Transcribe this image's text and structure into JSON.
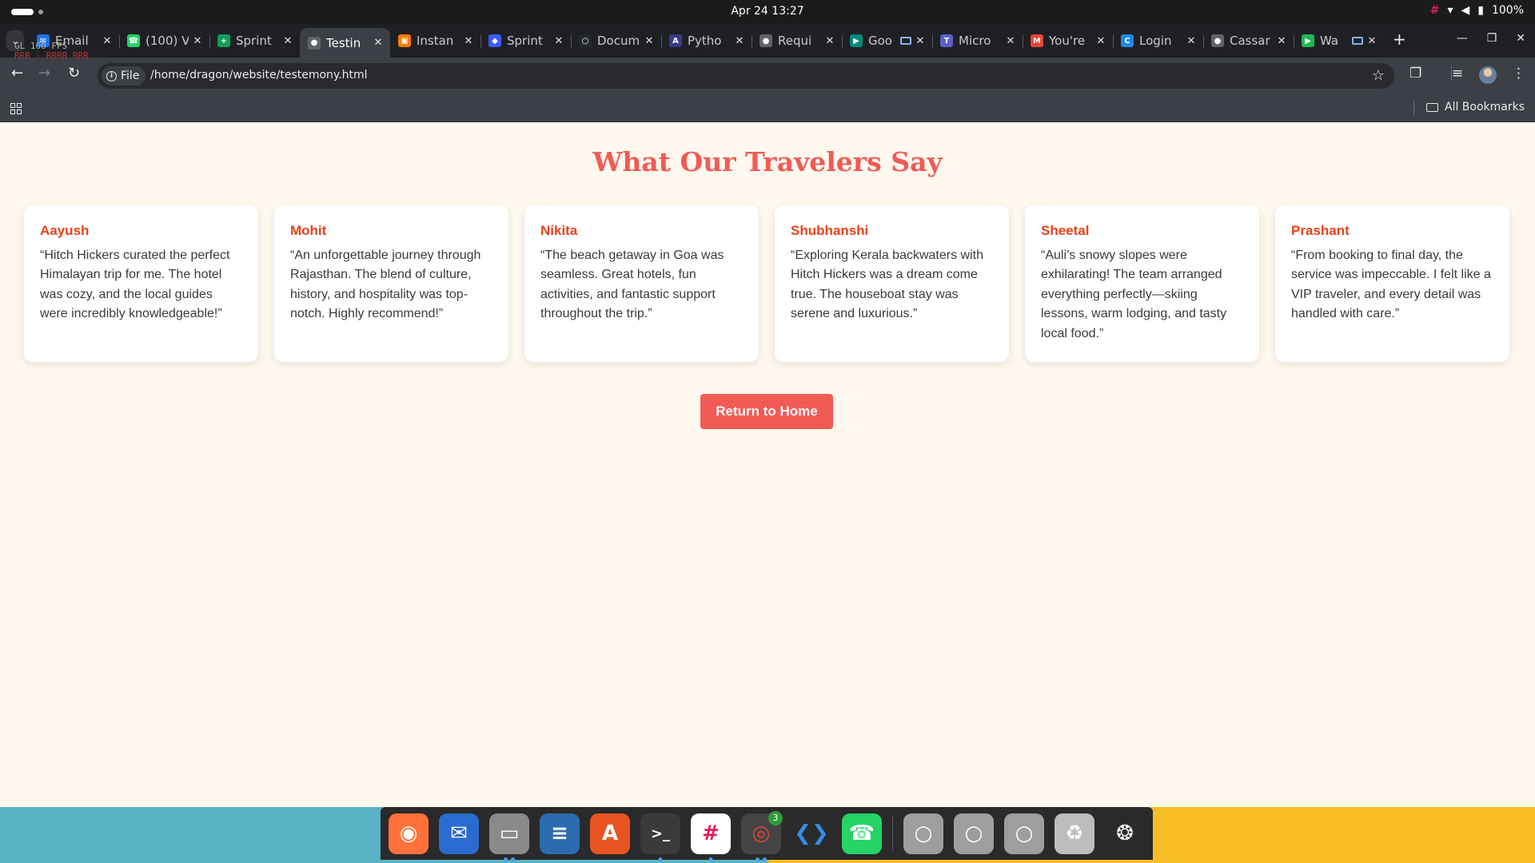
{
  "system": {
    "datetime": "Apr 24  13:27",
    "battery": "100%"
  },
  "overlay": {
    "line1": "GL 100 FPS",
    "line2": "RRR - RRRR RRR"
  },
  "tabs": [
    {
      "title": "Email",
      "icon": "email-icon",
      "color": "#1a73e8",
      "glyph": "✉"
    },
    {
      "title": "(100) V",
      "icon": "whatsapp-icon",
      "color": "#25d366",
      "glyph": "☎"
    },
    {
      "title": "Sprint",
      "icon": "sheets-icon",
      "color": "#0f9d58",
      "glyph": "+"
    },
    {
      "title": "Testin",
      "icon": "globe-icon",
      "color": "#5f6368",
      "glyph": "●",
      "active": true
    },
    {
      "title": "Instan",
      "icon": "instance-icon",
      "color": "#f57c00",
      "glyph": "▣"
    },
    {
      "title": "Sprint",
      "icon": "jira-icon",
      "color": "#3d5afe",
      "glyph": "◆"
    },
    {
      "title": "Docum",
      "icon": "github-icon",
      "color": "#24292e",
      "glyph": "○"
    },
    {
      "title": "Pytho",
      "icon": "python-icon",
      "color": "#3a3a8a",
      "glyph": "A"
    },
    {
      "title": "Requi",
      "icon": "globe-icon",
      "color": "#5f6368",
      "glyph": "●"
    },
    {
      "title": "Goo",
      "icon": "meet-icon",
      "color": "#00897b",
      "glyph": "▶",
      "extra": true
    },
    {
      "title": "Micro",
      "icon": "teams-icon",
      "color": "#5b5fc7",
      "glyph": "T"
    },
    {
      "title": "You're",
      "icon": "gmail-icon",
      "color": "#ea4335",
      "glyph": "M"
    },
    {
      "title": "Login",
      "icon": "login-icon",
      "color": "#1e88e5",
      "glyph": "C"
    },
    {
      "title": "Cassar",
      "icon": "globe-icon",
      "color": "#5f6368",
      "glyph": "●"
    },
    {
      "title": "Wa",
      "icon": "play-icon",
      "color": "#1db954",
      "glyph": "▶",
      "extra": true
    }
  ],
  "toolbar": {
    "chip_label": "File",
    "url": "/home/dragon/website/testemony.html"
  },
  "bookmarks": {
    "all_label": "All Bookmarks"
  },
  "page": {
    "title": "What Our Travelers Say",
    "testimonials": [
      {
        "name": "Aayush",
        "text": "“Hitch Hickers curated the perfect Himalayan trip for me. The hotel was cozy, and the local guides were incredibly knowledgeable!”"
      },
      {
        "name": "Mohit",
        "text": "“An unforgettable journey through Rajasthan. The blend of culture, history, and hospitality was top-notch. Highly recommend!”"
      },
      {
        "name": "Nikita",
        "text": "“The beach getaway in Goa was seamless. Great hotels, fun activities, and fantastic support throughout the trip.”"
      },
      {
        "name": "Shubhanshi",
        "text": "“Exploring Kerala backwaters with Hitch Hickers was a dream come true. The houseboat stay was serene and luxurious.”"
      },
      {
        "name": "Sheetal",
        "text": "“Auli’s snowy slopes were exhilarating! The team arranged everything perfectly—skiing lessons, warm lodging, and tasty local food.”"
      },
      {
        "name": "Prashant",
        "text": "“From booking to final day, the service was impeccable. I felt like a VIP traveler, and every detail was handled with care.”"
      }
    ],
    "return_button": "Return to Home"
  },
  "dock": {
    "chrome_badge": "3",
    "apps": [
      {
        "name": "firefox",
        "bg": "#ff7139",
        "glyph": "◉"
      },
      {
        "name": "thunderbird",
        "bg": "#2a6bd1",
        "glyph": "✉"
      },
      {
        "name": "files",
        "bg": "#8a8a8a",
        "glyph": "▭"
      },
      {
        "name": "writer",
        "bg": "#2b6cb0",
        "glyph": "≡"
      },
      {
        "name": "app-center",
        "bg": "#e95420",
        "glyph": "A"
      },
      {
        "name": "terminal",
        "bg": "#3a3a3a",
        "glyph": ">_"
      },
      {
        "name": "slack",
        "bg": "#ffffff",
        "glyph": "#"
      },
      {
        "name": "chrome",
        "bg": "#444444",
        "glyph": "◎"
      },
      {
        "name": "vscode",
        "bg": "#2a2a2a",
        "glyph": "❮❯"
      },
      {
        "name": "whatsapp",
        "bg": "#25d366",
        "glyph": "☎"
      },
      {
        "name": "disk-1",
        "bg": "#9e9e9e",
        "glyph": "○"
      },
      {
        "name": "disk-2",
        "bg": "#9e9e9e",
        "glyph": "○"
      },
      {
        "name": "disk-3",
        "bg": "#9e9e9e",
        "glyph": "○"
      },
      {
        "name": "trash",
        "bg": "#bdbdbd",
        "glyph": "♻"
      },
      {
        "name": "show-apps",
        "bg": "#2a2a2a",
        "glyph": "❂"
      }
    ]
  },
  "colors": {
    "accent": "#f25a55",
    "name_color": "#e9421b",
    "page_bg": "#fff8ef"
  }
}
